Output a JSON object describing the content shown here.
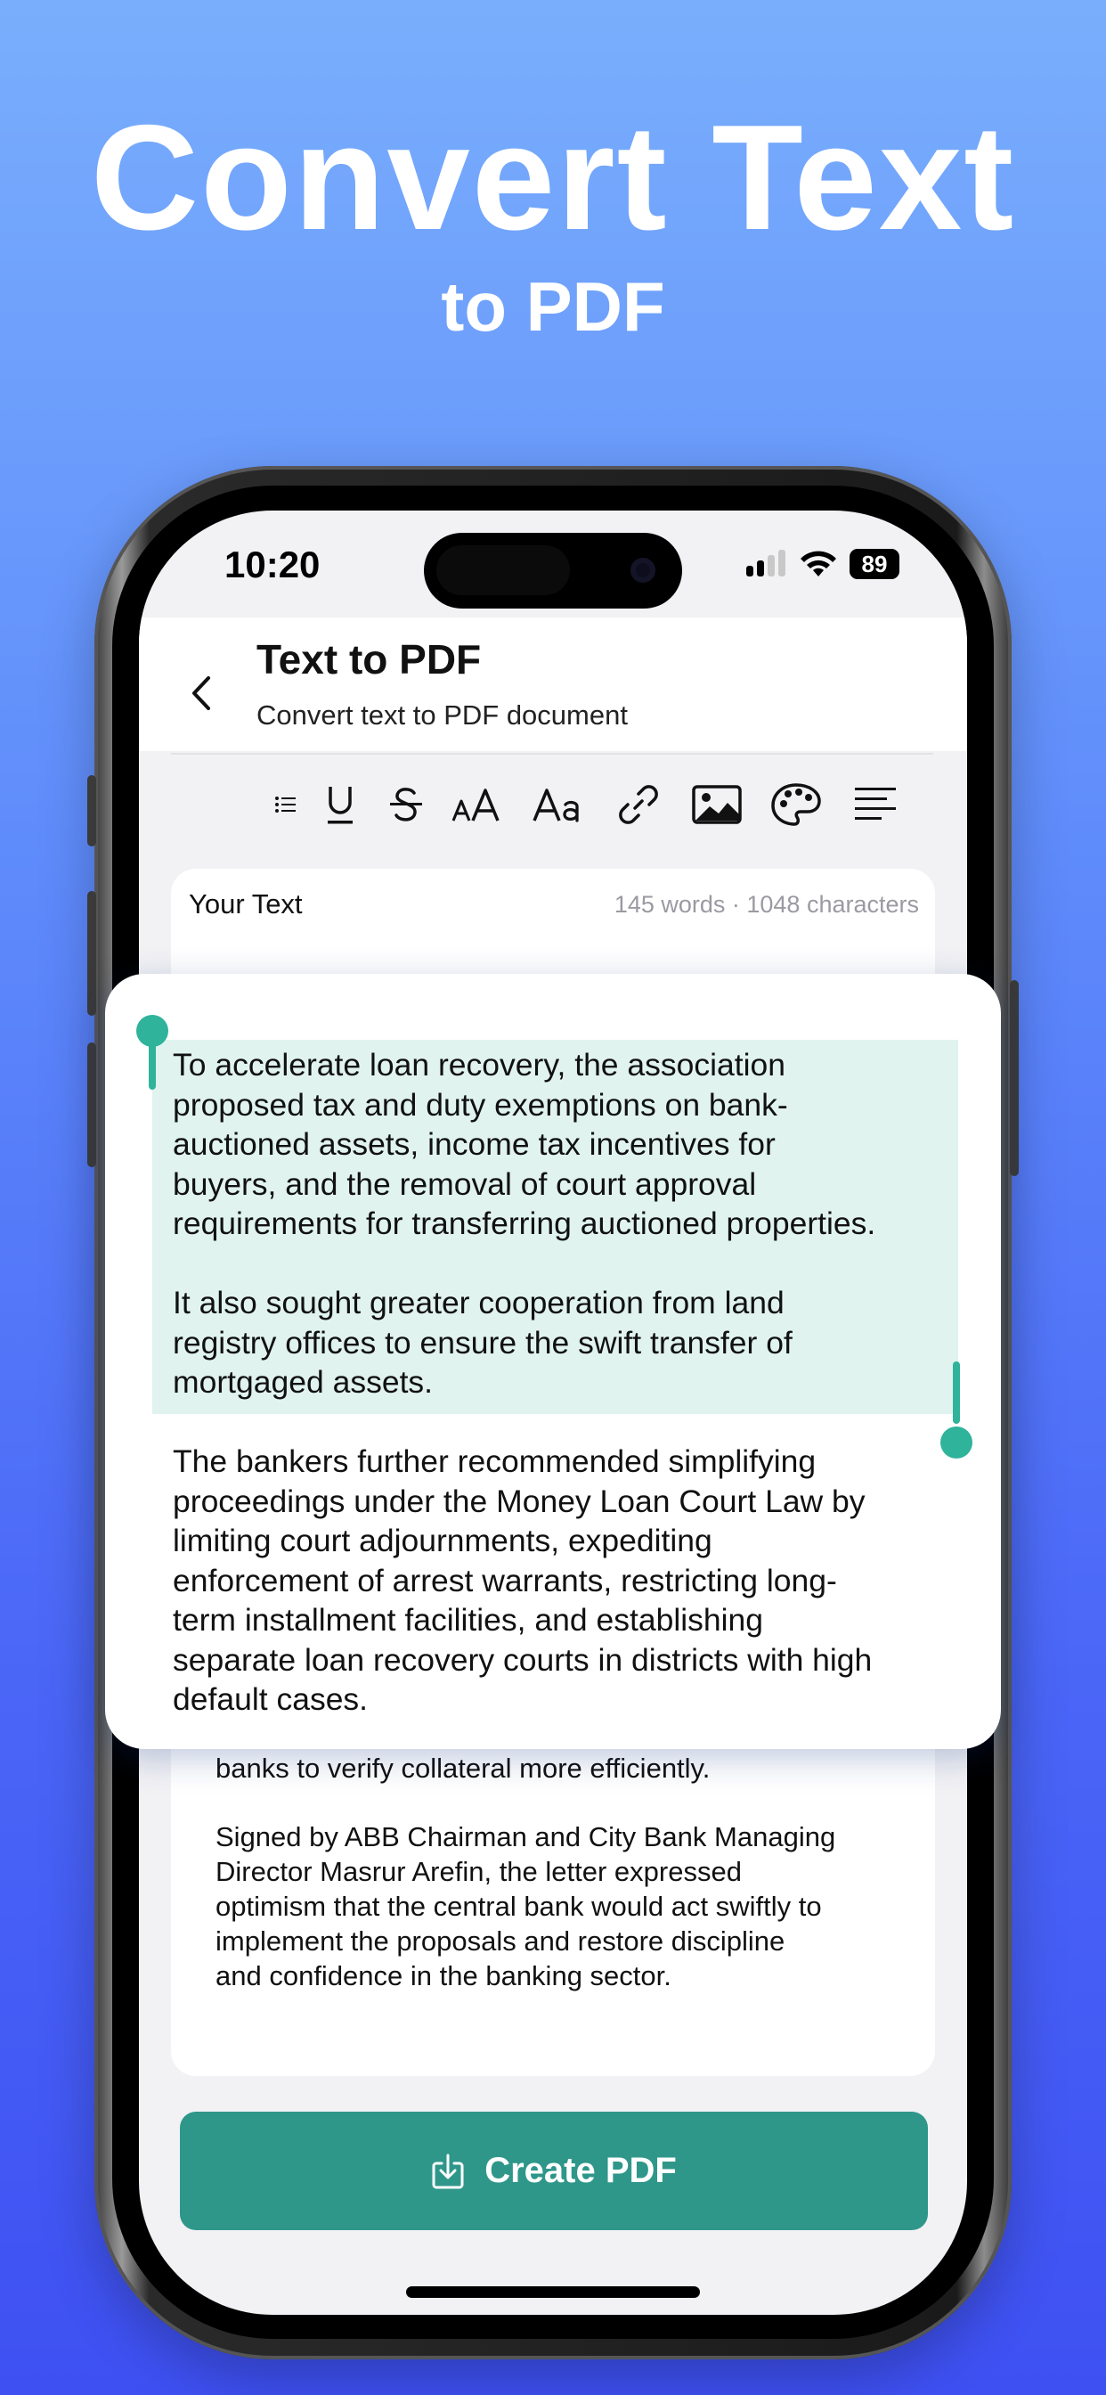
{
  "promo": {
    "headline": "Convert Text",
    "subheadline": "to PDF"
  },
  "status_bar": {
    "time": "10:20",
    "battery": "89"
  },
  "header": {
    "title": "Text to PDF",
    "subtitle": "Convert text to PDF document"
  },
  "toolbar": {
    "items": [
      "list-icon",
      "underline-icon",
      "strikethrough-icon",
      "text-size-icon",
      "font-icon",
      "link-icon",
      "image-icon",
      "palette-icon",
      "align-icon"
    ]
  },
  "editor": {
    "label": "Your Text",
    "stats": "145 words · 1048 characters",
    "visible_paragraphs": [
      "banks to verify collateral more efficiently.",
      "Signed by ABB Chairman and City Bank Managing\nDirector Masrur Arefin, the letter expressed\noptimism that the central bank would act swiftly to\nimplement the proposals and restore discipline\nand confidence in the banking sector."
    ]
  },
  "zoom": {
    "paragraphs": [
      "To accelerate loan recovery, the association\nproposed tax and duty exemptions on bank-\nauctioned assets, income tax incentives for\nbuyers, and the removal of court approval\nrequirements for transferring auctioned properties.",
      "It also sought greater cooperation from land\nregistry offices to ensure the swift transfer of\nmortgaged assets.",
      "The bankers further recommended simplifying\nproceedings under the Money Loan Court Law by\nlimiting court adjournments, expediting\nenforcement of arrest warrants, restricting long-\nterm installment facilities, and establishing\nseparate loan recovery courts in districts with high\ndefault cases."
    ]
  },
  "actions": {
    "create_label": "Create PDF"
  }
}
